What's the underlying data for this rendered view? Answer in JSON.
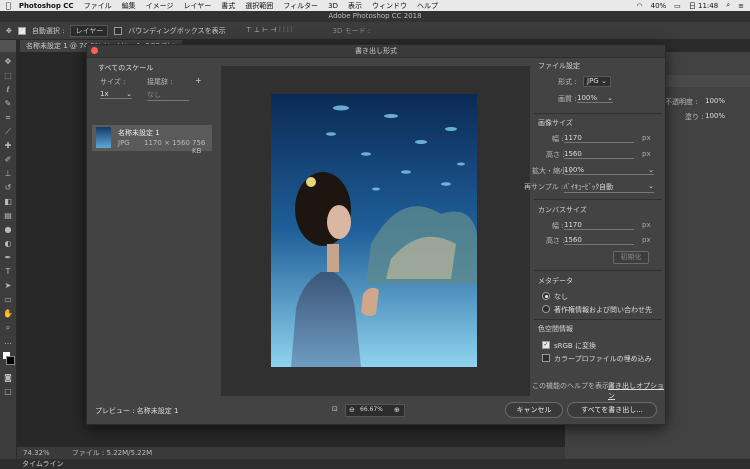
{
  "menubar": {
    "app": "Photoshop CC",
    "items": [
      "ファイル",
      "編集",
      "イメージ",
      "レイヤー",
      "書式",
      "選択範囲",
      "フィルター",
      "3D",
      "表示",
      "ウィンドウ",
      "ヘルプ"
    ],
    "battery": "40%",
    "clock": "日 11:48"
  },
  "ps_title": "Adobe Photoshop CC 2018",
  "options": {
    "auto_select_label": "自動選択 :",
    "auto_select_value": "レイヤー",
    "bbox_label": "バウンディングボックスを表示",
    "mode_3d": "3D モード :"
  },
  "doc_tab": "名称未設定 1 @ 74.3% (レイヤー 1, RGB/8) *",
  "status": {
    "zoom": "74.32%",
    "file": "ファイル : 5.22M/5.22M"
  },
  "timeline": "タイムライン",
  "right_panel": {
    "opacity_label": "不透明度 :",
    "opacity": "100%",
    "fill_label": "塗り :",
    "fill": "100%"
  },
  "dialog": {
    "title": "書き出し形式",
    "all_scales": "すべてのスケール",
    "size_label": "サイズ :",
    "suffix_label": "接尾辞 :",
    "scale_value": "1x",
    "suffix_placeholder": "なし",
    "add_icon": "+",
    "asset": {
      "name": "名称未設定 1",
      "format": "JPG",
      "dims": "1170 × 1560",
      "filesize": "756 KB"
    },
    "preview_label": "プレビュー : 名称未設定 1",
    "zoom": "66.67%",
    "file_settings": {
      "header": "ファイル設定",
      "format_label": "形式 :",
      "format": "JPG",
      "quality_label": "画質 :",
      "quality": "100%"
    },
    "image_size": {
      "header": "画像サイズ",
      "width_label": "幅 :",
      "width": "1170",
      "width_unit": "px",
      "height_label": "高さ :",
      "height": "1560",
      "height_unit": "px",
      "scale_label": "拡大・縮小 :",
      "scale": "100%",
      "resample_label": "再サンプル :",
      "resample": "ﾊﾞｲｷｭｰﾋﾞｯｸ自動"
    },
    "canvas_size": {
      "header": "カンバスサイズ",
      "width_label": "幅 :",
      "width": "1170",
      "width_unit": "px",
      "height_label": "高さ :",
      "height": "1560",
      "height_unit": "px",
      "reset": "初期化"
    },
    "metadata": {
      "header": "メタデータ",
      "none": "なし",
      "copyright": "著作権情報および問い合わせ先"
    },
    "color_space": {
      "header": "色空間情報",
      "srgb": "sRGB に変換",
      "embed": "カラープロファイルの埋め込み"
    },
    "help_text": "この機能のヘルプを表示 :",
    "help_link": "書き出しオプション",
    "cancel": "キャンセル",
    "export_all": "すべてを書き出し..."
  }
}
